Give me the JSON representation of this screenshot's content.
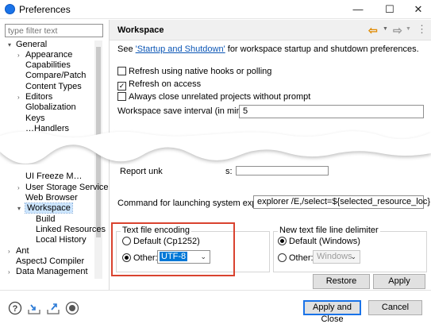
{
  "window": {
    "title": "Preferences",
    "minimize": "—",
    "maximize": "☐",
    "close": "✕"
  },
  "sidebar": {
    "filter_placeholder": "type filter text",
    "items_top": [
      {
        "label": "General",
        "twisty": "▾"
      },
      {
        "label": "Appearance",
        "twisty": "›"
      },
      {
        "label": "Capabilities",
        "twisty": ""
      },
      {
        "label": "Compare/Patch",
        "twisty": ""
      },
      {
        "label": "Content Types",
        "twisty": ""
      },
      {
        "label": "Editors",
        "twisty": "›"
      },
      {
        "label": "Globalization",
        "twisty": ""
      },
      {
        "label": "Keys",
        "twisty": ""
      },
      {
        "label": "…Handlers",
        "twisty": ""
      }
    ],
    "items_bottom": [
      {
        "label": "UI Freeze M…",
        "twisty": ""
      },
      {
        "label": "User Storage Service",
        "twisty": "›"
      },
      {
        "label": "Web Browser",
        "twisty": ""
      },
      {
        "label": "Workspace",
        "twisty": "▾"
      },
      {
        "label": "Build",
        "twisty": ""
      },
      {
        "label": "Linked Resources",
        "twisty": ""
      },
      {
        "label": "Local History",
        "twisty": ""
      },
      {
        "label": "Ant",
        "twisty": "›"
      },
      {
        "label": "AspectJ Compiler",
        "twisty": ""
      },
      {
        "label": "Data Management",
        "twisty": "›"
      }
    ]
  },
  "page": {
    "title": "Workspace",
    "intro_prefix": "See ",
    "intro_link": "'Startup and Shutdown'",
    "intro_suffix": " for workspace startup and shutdown preferences.",
    "options": [
      {
        "label": "Refresh using native hooks or polling",
        "checked": false
      },
      {
        "label": "Refresh on access",
        "checked": true
      },
      {
        "label": "Always close unrelated projects without prompt",
        "checked": false
      }
    ],
    "save_interval_label": "Workspace save interval (in minutes):",
    "save_interval_value": "5",
    "report_label_a": "Report unk",
    "report_label_b": "s:",
    "explorer_label": "Command for launching system explorer:",
    "explorer_value": "explorer /E,/select=${selected_resource_loc}",
    "encoding": {
      "title": "Text file encoding",
      "default_label": "Default (Cp1252)",
      "other_label": "Other:",
      "other_value": "UTF-8",
      "selected": "Other"
    },
    "delimiter": {
      "title": "New text file line delimiter",
      "default_label": "Default (Windows)",
      "other_label": "Other:",
      "other_value": "Windows",
      "selected": "Default"
    },
    "restore_defaults": "Restore Defaults",
    "apply": "Apply"
  },
  "footer": {
    "apply_close": "Apply and Close",
    "cancel": "Cancel",
    "icons": [
      "help-icon",
      "import-icon",
      "export-icon",
      "record-icon"
    ]
  },
  "colors": {
    "accent": "#1a73e8",
    "highlight_box": "#d9432f",
    "link": "#0a55b5",
    "nav_back": "#e08a00"
  }
}
